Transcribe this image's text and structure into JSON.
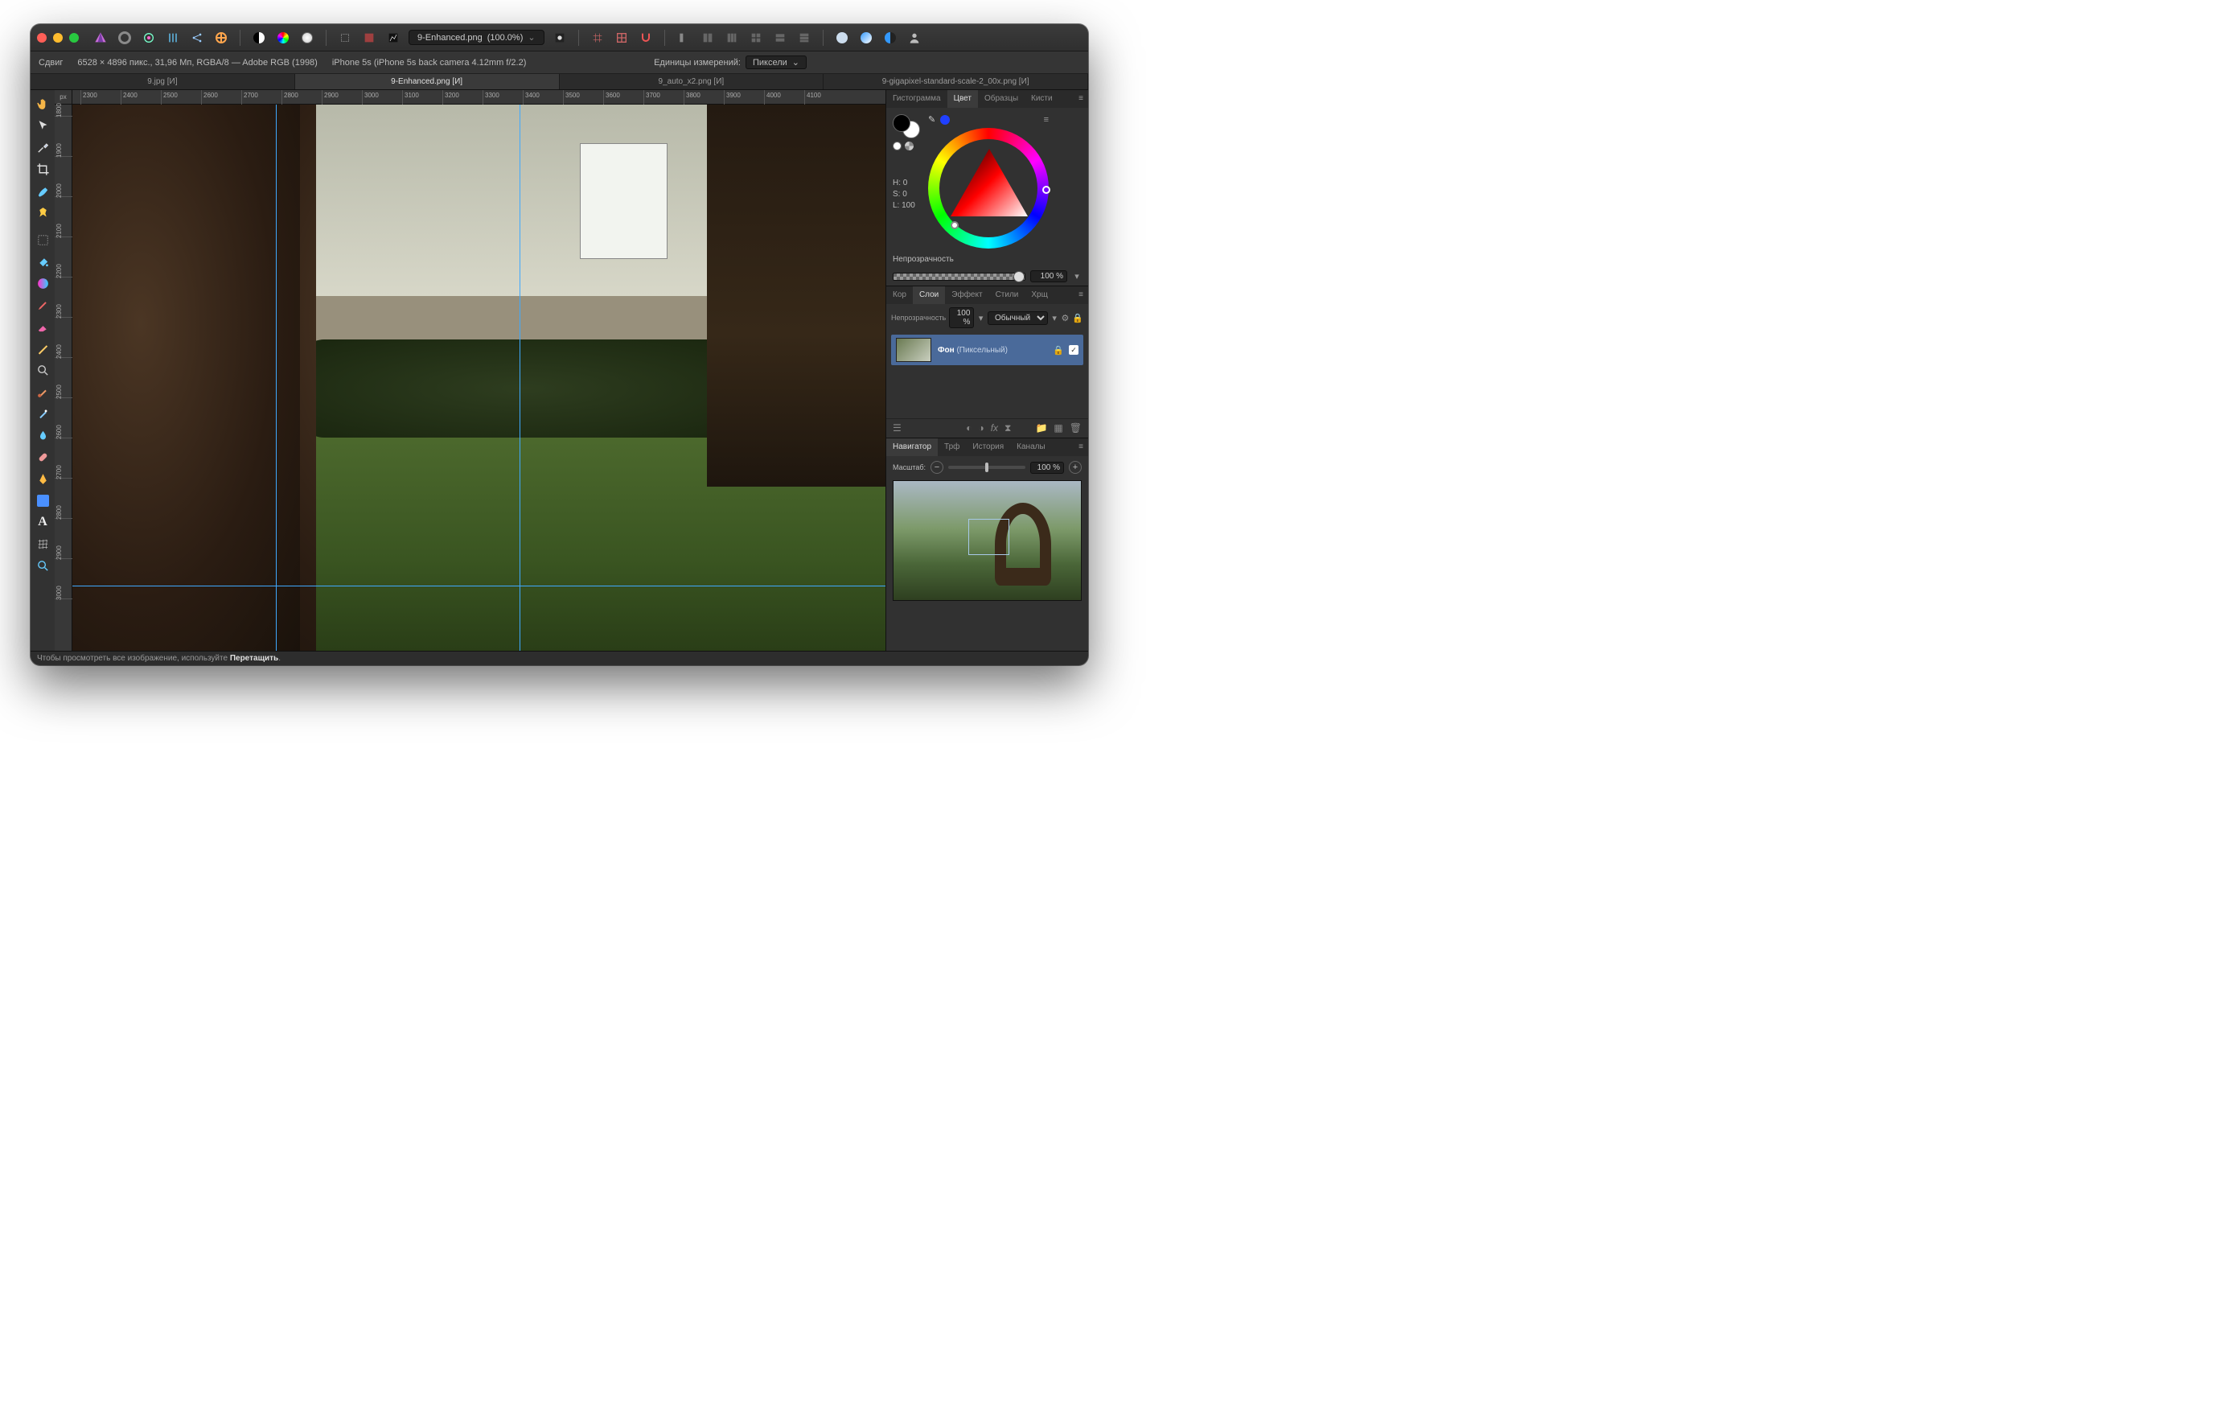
{
  "window_title": {
    "filename": "9-Enhanced.png",
    "zoom": "(100.0%)"
  },
  "infobar": {
    "shift_label": "Сдвиг",
    "dimensions": "6528 × 4896 пикс., 31,96 Мп, RGBA/8 — Adobe RGB (1998)",
    "camera": "iPhone 5s (iPhone 5s back camera 4.12mm f/2.2)",
    "units_label": "Единицы измерений:",
    "units_value": "Пиксели"
  },
  "tabs": [
    {
      "label": "9.jpg [И]"
    },
    {
      "label": "9-Enhanced.png [И]",
      "active": true
    },
    {
      "label": "9_auto_x2.png [И]"
    },
    {
      "label": "9-gigapixel-standard-scale-2_00x.png [И]"
    }
  ],
  "ruler_unit": "px",
  "ruler_h": [
    "2300",
    "2400",
    "2500",
    "2600",
    "2700",
    "2800",
    "2900",
    "3000",
    "3100",
    "3200",
    "3300",
    "3400",
    "3500",
    "3600",
    "3700",
    "3800",
    "3900",
    "4000",
    "4100"
  ],
  "ruler_v": [
    "1800",
    "1900",
    "2000",
    "2100",
    "2200",
    "2300",
    "2400",
    "2500",
    "2600",
    "2700",
    "2800",
    "2900",
    "3000"
  ],
  "right_tabs_top": [
    "Гистограмма",
    "Цвет",
    "Образцы",
    "Кисти"
  ],
  "right_tabs_top_active": 1,
  "color": {
    "H": "H: 0",
    "S": "S: 0",
    "L": "L: 100",
    "opacity_label": "Непрозрачность",
    "opacity_value": "100 %"
  },
  "right_tabs_mid": [
    "Кор",
    "Слои",
    "Эффект",
    "Стили",
    "Хрщ"
  ],
  "right_tabs_mid_active": 1,
  "layers_panel": {
    "opacity_label": "Непрозрачность",
    "opacity_value": "100 %",
    "blend": "Обычный",
    "layer_name": "Фон",
    "layer_kind": "(Пиксельный)"
  },
  "nav_tabs": [
    "Навигатор",
    "Трф",
    "История",
    "Каналы"
  ],
  "nav_tabs_active": 0,
  "nav": {
    "zoom_label": "Масштаб:",
    "zoom_value": "100 %"
  },
  "status": {
    "pre": "Чтобы просмотреть все изображение, используйте ",
    "bold": "Перетащить",
    "post": "."
  }
}
